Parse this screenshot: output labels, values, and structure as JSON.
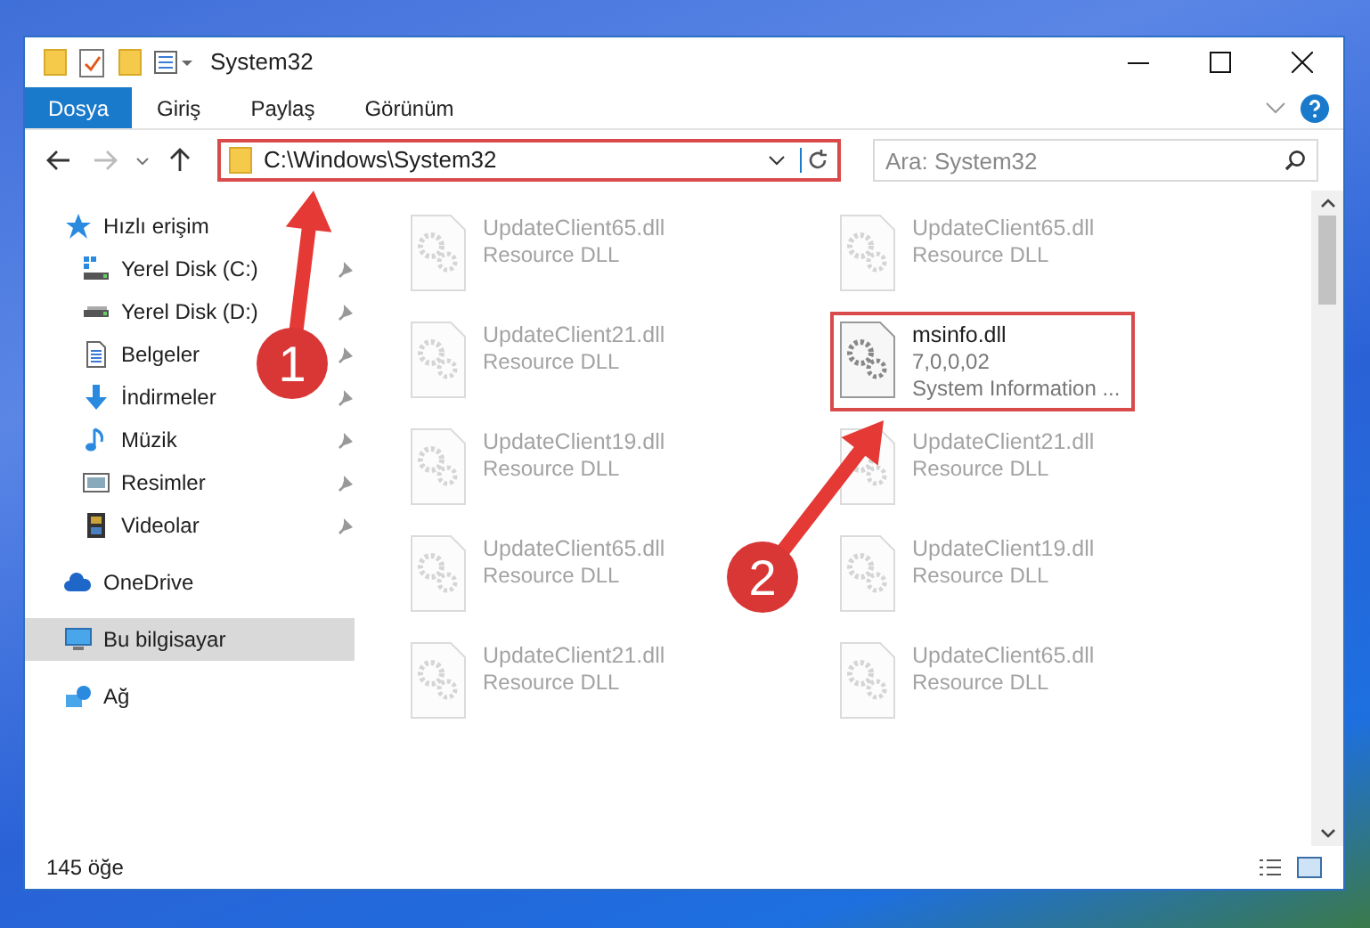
{
  "window": {
    "title": "System32"
  },
  "ribbon_tabs": [
    {
      "label": "Dosya",
      "kind": "file"
    },
    {
      "label": "Giriş",
      "kind": "tab"
    },
    {
      "label": "Paylaş",
      "kind": "tab"
    },
    {
      "label": "Görünüm",
      "kind": "tab"
    }
  ],
  "address": {
    "path": "C:\\Windows\\System32",
    "highlighted": true
  },
  "search": {
    "placeholder": "Ara: System32"
  },
  "sidebar": {
    "items": [
      {
        "label": "Hızlı erişim",
        "kind": "star",
        "selected": false,
        "children": [
          {
            "label": "Yerel Disk (C:)",
            "kind": "system-drive",
            "selected": false,
            "pinned": true
          },
          {
            "label": "Yerel Disk (D:)",
            "kind": "drive",
            "selected": false,
            "pinned": true
          },
          {
            "label": "Belgeler",
            "kind": "documents",
            "selected": false,
            "pinned": true
          },
          {
            "label": "İndirmeler",
            "kind": "download",
            "selected": false,
            "pinned": true
          },
          {
            "label": "Müzik",
            "kind": "music",
            "selected": false,
            "pinned": true
          },
          {
            "label": "Resimler",
            "kind": "pictures",
            "selected": false,
            "pinned": true
          },
          {
            "label": "Videolar",
            "kind": "videos",
            "selected": false,
            "pinned": true
          }
        ]
      },
      {
        "label": "OneDrive",
        "kind": "cloud",
        "selected": false
      },
      {
        "label": "Bu bilgisayar",
        "kind": "computer",
        "selected": true
      },
      {
        "label": "Ağ",
        "kind": "network",
        "selected": false
      }
    ]
  },
  "files": [
    {
      "name": "UpdateClient65.dll",
      "description": "Resource DLL",
      "highlighted": false
    },
    {
      "name": "UpdateClient65.dll",
      "description": "Resource DLL",
      "highlighted": false
    },
    {
      "name": "UpdateClient21.dll",
      "description": "Resource DLL",
      "highlighted": false
    },
    {
      "name": "msinfo.dll",
      "version": "7,0,0,02",
      "description": "System Information ...",
      "highlighted": true
    },
    {
      "name": "UpdateClient19.dll",
      "description": "Resource DLL",
      "highlighted": false
    },
    {
      "name": "UpdateClient21.dll",
      "description": "Resource DLL",
      "highlighted": false
    },
    {
      "name": "UpdateClient65.dll",
      "description": "Resource DLL",
      "highlighted": false
    },
    {
      "name": "UpdateClient19.dll",
      "description": "Resource DLL",
      "highlighted": false
    },
    {
      "name": "UpdateClient21.dll",
      "description": "Resource DLL",
      "highlighted": false
    },
    {
      "name": "UpdateClient65.dll",
      "description": "Resource DLL",
      "highlighted": false
    }
  ],
  "annotations": [
    {
      "label": "1"
    },
    {
      "label": "2"
    }
  ],
  "status_bar": {
    "count": "145 öğe"
  }
}
